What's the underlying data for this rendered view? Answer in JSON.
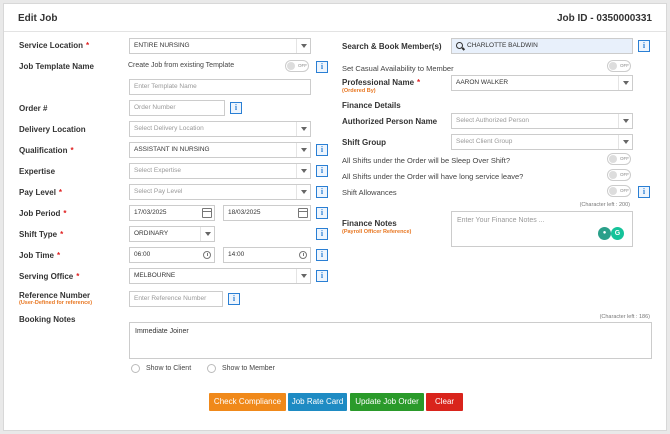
{
  "header": {
    "title": "Edit Job",
    "job_id": "Job ID - 0350000331"
  },
  "left": {
    "service_location": {
      "label": "Service Location",
      "value": "ENTIRE NURSING"
    },
    "job_template": {
      "label": "Job Template Name",
      "create_from": "Create Job from existing Template",
      "toggle": "OFF",
      "placeholder": "Enter Template Name"
    },
    "order": {
      "label": "Order #",
      "placeholder": "Order Number"
    },
    "delivery_location": {
      "label": "Delivery Location",
      "placeholder": "Select Delivery Location"
    },
    "qualification": {
      "label": "Qualification",
      "value": "ASSISTANT IN NURSING"
    },
    "expertise": {
      "label": "Expertise",
      "placeholder": "Select Expertise"
    },
    "pay_level": {
      "label": "Pay Level",
      "placeholder": "Select Pay Level"
    },
    "job_period": {
      "label": "Job Period",
      "start": "17/03/2025",
      "end": "18/03/2025"
    },
    "shift_type": {
      "label": "Shift Type",
      "value": "ORDINARY"
    },
    "job_time": {
      "label": "Job Time",
      "start": "06:00",
      "end": "14:00"
    },
    "serving_office": {
      "label": "Serving Office",
      "value": "MELBOURNE"
    },
    "reference_number": {
      "label": "Reference Number",
      "sublabel": "(User-Defined for reference)",
      "placeholder": "Enter Reference Number"
    },
    "booking_notes": {
      "label": "Booking Notes",
      "char_left": "(Character left : 186)",
      "value": "Immediate Joiner"
    },
    "show_to_client": "Show to Client",
    "show_to_member": "Show to Member"
  },
  "right": {
    "search_member": {
      "label": "Search & Book Member(s)",
      "value": "CHARLOTTE BALDWIN"
    },
    "casual_availability": {
      "label": "Set Casual Availability to Member",
      "toggle": "OFF"
    },
    "professional_name": {
      "label": "Professional Name",
      "sublabel": "(Ordered By)",
      "value": "AARON WALKER"
    },
    "finance_details": "Finance Details",
    "authorized_person": {
      "label": "Authorized Person Name",
      "placeholder": "Select Authorized Person"
    },
    "shift_group": {
      "label": "Shift Group",
      "placeholder": "Select Client Group"
    },
    "sleep_over": {
      "label": "All Shifts under the Order will be Sleep Over Shift?",
      "toggle": "OFF"
    },
    "long_service": {
      "label": "All Shifts under the Order will have long service leave?",
      "toggle": "OFF"
    },
    "shift_allowances": {
      "label": "Shift Allowances",
      "toggle": "OFF"
    },
    "finance_notes": {
      "label": "Finance Notes",
      "sublabel": "(Payroll Officer Reference)",
      "char_left": "(Character left : 200)",
      "placeholder": "Enter Your Finance Notes ..."
    }
  },
  "actions": {
    "check_compliance": "Check Compliance",
    "job_rate_card": "Job Rate Card",
    "update_job_order": "Update Job Order",
    "clear": "Clear"
  },
  "colors": {
    "orange": "#f0891a",
    "blue": "#1e8bc3",
    "green": "#2a9a2a",
    "red": "#d9241c",
    "info": "#2a7fd4"
  },
  "icons": [
    "chevron-down-icon",
    "info-icon",
    "calendar-icon",
    "clock-icon",
    "search-icon",
    "grammarly-icon"
  ]
}
